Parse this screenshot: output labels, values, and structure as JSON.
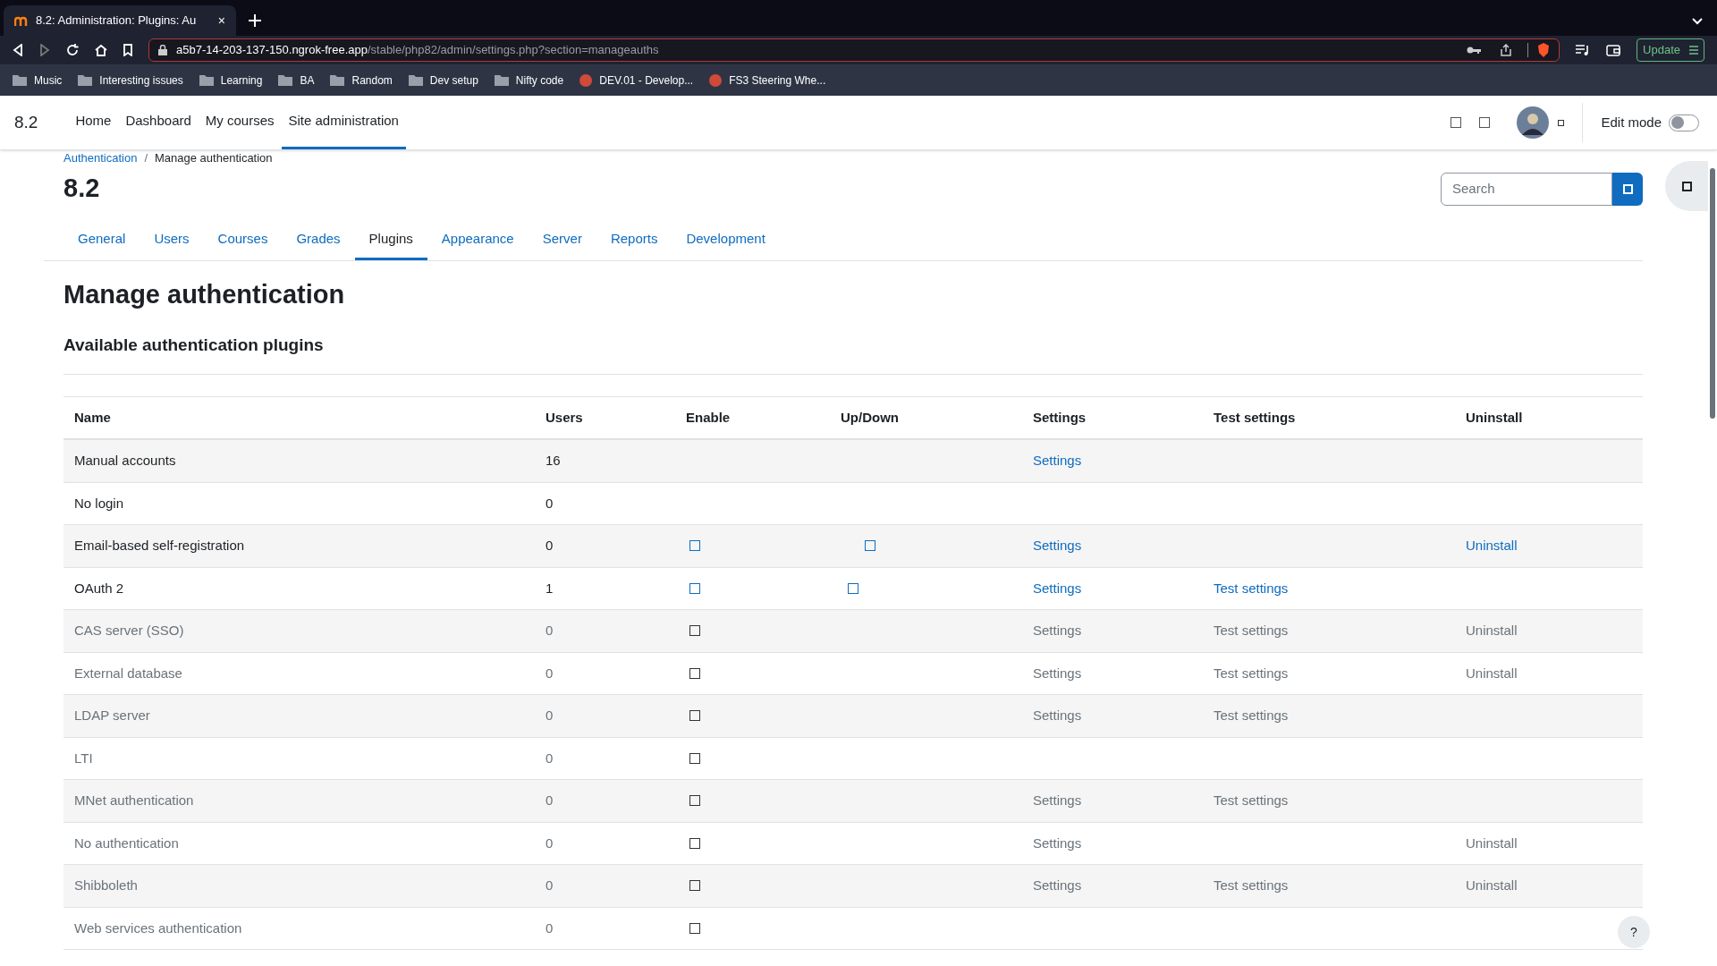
{
  "browser": {
    "tab_title": "8.2: Administration: Plugins: Au",
    "tab_close": "×",
    "url_host": "a5b7-14-203-137-150.ngrok-free.app",
    "url_path": "/stable/php82/admin/settings.php?section=manageauths",
    "update_button": "Update",
    "bookmarks": [
      {
        "label": "Music",
        "kind": "folder"
      },
      {
        "label": "Interesting issues",
        "kind": "folder"
      },
      {
        "label": "Learning",
        "kind": "folder"
      },
      {
        "label": "BA",
        "kind": "folder"
      },
      {
        "label": "Random",
        "kind": "folder"
      },
      {
        "label": "Dev setup",
        "kind": "folder"
      },
      {
        "label": "Nifty code",
        "kind": "folder"
      },
      {
        "label": "DEV.01 - Develop...",
        "kind": "site"
      },
      {
        "label": "FS3 Steering Whe...",
        "kind": "site"
      }
    ]
  },
  "navbar": {
    "brand": "8.2",
    "items": [
      {
        "label": "Home",
        "selected": false
      },
      {
        "label": "Dashboard",
        "selected": false
      },
      {
        "label": "My courses",
        "selected": false
      },
      {
        "label": "Site administration",
        "selected": true
      }
    ],
    "edit_mode": {
      "label": "Edit mode",
      "on": false
    }
  },
  "breadcrumb": [
    "Authentication",
    "Manage authentication"
  ],
  "breadcrumb_separator": "/",
  "page_title": "8.2",
  "search": {
    "placeholder": "Search"
  },
  "tabs": [
    {
      "label": "General",
      "selected": false
    },
    {
      "label": "Users",
      "selected": false
    },
    {
      "label": "Courses",
      "selected": false
    },
    {
      "label": "Grades",
      "selected": false
    },
    {
      "label": "Plugins",
      "selected": true
    },
    {
      "label": "Appearance",
      "selected": false
    },
    {
      "label": "Server",
      "selected": false
    },
    {
      "label": "Reports",
      "selected": false
    },
    {
      "label": "Development",
      "selected": false
    }
  ],
  "heading": "Manage authentication",
  "subheading": "Available authentication plugins",
  "table": {
    "columns": [
      "Name",
      "Users",
      "Enable",
      "Up/Down",
      "Settings",
      "Test settings",
      "Uninstall"
    ],
    "rows": [
      {
        "name": "Manual accounts",
        "users": "16",
        "enabled": true,
        "toggle": false,
        "settings": "Settings"
      },
      {
        "name": "No login",
        "users": "0",
        "enabled": true,
        "toggle": false
      },
      {
        "name": "Email-based self-registration",
        "users": "0",
        "enabled": true,
        "toggle": true,
        "move_down": true,
        "settings": "Settings",
        "uninstall": "Uninstall"
      },
      {
        "name": "OAuth 2",
        "users": "1",
        "enabled": true,
        "toggle": true,
        "move_up": true,
        "settings": "Settings",
        "test_settings": "Test settings"
      },
      {
        "name": "CAS server (SSO)",
        "users": "0",
        "enabled": false,
        "toggle": true,
        "settings": "Settings",
        "test_settings": "Test settings",
        "uninstall": "Uninstall"
      },
      {
        "name": "External database",
        "users": "0",
        "enabled": false,
        "toggle": true,
        "settings": "Settings",
        "test_settings": "Test settings",
        "uninstall": "Uninstall"
      },
      {
        "name": "LDAP server",
        "users": "0",
        "enabled": false,
        "toggle": true,
        "settings": "Settings",
        "test_settings": "Test settings"
      },
      {
        "name": "LTI",
        "users": "0",
        "enabled": false,
        "toggle": true
      },
      {
        "name": "MNet authentication",
        "users": "0",
        "enabled": false,
        "toggle": true,
        "settings": "Settings",
        "test_settings": "Test settings"
      },
      {
        "name": "No authentication",
        "users": "0",
        "enabled": false,
        "toggle": true,
        "settings": "Settings",
        "uninstall": "Uninstall"
      },
      {
        "name": "Shibboleth",
        "users": "0",
        "enabled": false,
        "toggle": true,
        "settings": "Settings",
        "test_settings": "Test settings",
        "uninstall": "Uninstall"
      },
      {
        "name": "Web services authentication",
        "users": "0",
        "enabled": false,
        "toggle": true
      }
    ]
  },
  "help_button": "?"
}
